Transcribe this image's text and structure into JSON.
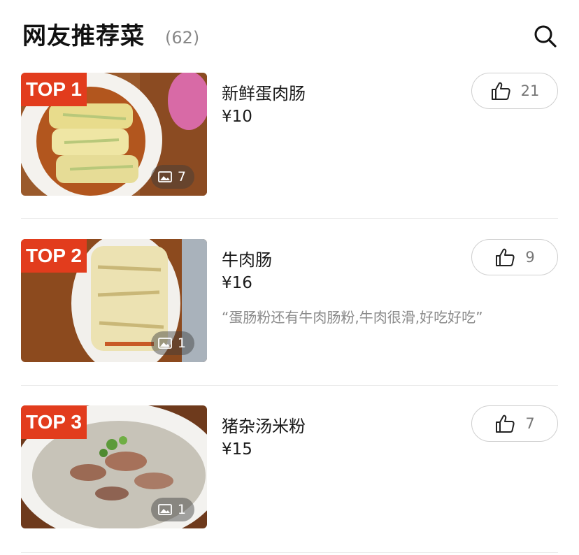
{
  "header": {
    "title": "网友推荐菜",
    "count": "(62)",
    "search_icon": "search-icon"
  },
  "dishes": [
    {
      "rank": "TOP 1",
      "name": "新鲜蛋肉肠",
      "price": "¥10",
      "quote": "",
      "photo_count": "7",
      "likes": "21"
    },
    {
      "rank": "TOP 2",
      "name": "牛肉肠",
      "price": "¥16",
      "quote": "“蛋肠粉还有牛肉肠粉,牛肉很滑,好吃好吃”",
      "photo_count": "1",
      "likes": "9"
    },
    {
      "rank": "TOP 3",
      "name": "猪杂汤米粉",
      "price": "¥15",
      "quote": "",
      "photo_count": "1",
      "likes": "7"
    }
  ],
  "colors": {
    "rank_badge": "#e23c1d",
    "like_border": "#cfcfcf"
  }
}
